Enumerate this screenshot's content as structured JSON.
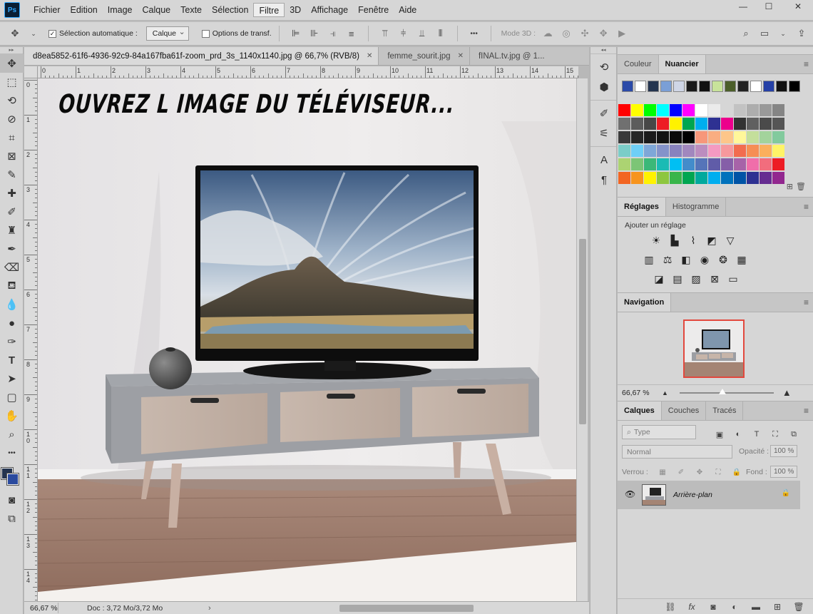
{
  "app": {
    "logo": "Ps"
  },
  "menu": [
    "Fichier",
    "Edition",
    "Image",
    "Calque",
    "Texte",
    "Sélection",
    "Filtre",
    "3D",
    "Affichage",
    "Fenêtre",
    "Aide"
  ],
  "menu_active_index": 6,
  "window_controls": {
    "minimize": "—",
    "maximize": "☐",
    "close": "✕"
  },
  "options": {
    "auto_select_label": "Sélection automatique :",
    "auto_select_checked": "✓",
    "auto_select_target": "Calque",
    "transform_label": "Options de transf.",
    "mode3d_label": "Mode 3D :",
    "more": "•••"
  },
  "doc_tabs": [
    {
      "label": "d8ea5852-61f6-4936-92c9-84a167fba61f-zoom_prd_3s_1140x1140.jpg @ 66,7% (RVB/8)",
      "close": "✕"
    },
    {
      "label": "femme_sourit.jpg",
      "close": "✕"
    },
    {
      "label": "fINAL.tv.jpg @ 1...",
      "close": ""
    }
  ],
  "rulers": {
    "top": [
      "0",
      "1",
      "2",
      "3",
      "4",
      "5",
      "6",
      "7",
      "8",
      "9",
      "10",
      "11",
      "12",
      "13",
      "14",
      "15"
    ],
    "left": [
      "0",
      "1",
      "2",
      "3",
      "4",
      "5",
      "6",
      "7",
      "8",
      "9",
      "10",
      "11",
      "12",
      "13",
      "14"
    ]
  },
  "canvas": {
    "headline": "OUVREZ L IMAGE DU TÉLÉVISEUR..."
  },
  "status": {
    "zoom": "66,67 %",
    "doc_info": "Doc : 3,72 Mo/3,72 Mo",
    "arrow": "›"
  },
  "panels": {
    "color": {
      "tabs": [
        "Couleur",
        "Nuancier"
      ]
    },
    "adjustments": {
      "tabs": [
        "Réglages",
        "Histogramme"
      ],
      "add_label": "Ajouter un réglage"
    },
    "navigation": {
      "tabs": [
        "Navigation"
      ],
      "zoom": "66,67 %"
    },
    "layers": {
      "tabs": [
        "Calques",
        "Couches",
        "Tracés"
      ],
      "filter_placeholder": "Type",
      "blend_mode": "Normal",
      "opacity_label": "Opacité :",
      "opacity_value": "100 %",
      "lock_label": "Verrou :",
      "fill_label": "Fond :",
      "fill_value": "100 %",
      "layer_name": "Arrière-plan"
    }
  },
  "swatch_colors": {
    "recent": [
      "#2b4aa8",
      "#ffffff",
      "#24344f",
      "#7a9fd6",
      "#cfd6e6",
      "#1a1a1a",
      "#111111",
      "#c8e39a",
      "#4b5e2a",
      "#222222",
      "#ffffff",
      "#2540a6",
      "#111111",
      "#000000"
    ],
    "grid": [
      [
        "#ff0000",
        "#ffff00",
        "#00ff00",
        "#00ffff",
        "#0000ff",
        "#ff00ff",
        "#ffffff",
        "#ebebeb",
        "#d6d6d6",
        "#c2c2c2",
        "#adadad",
        "#999999",
        "#858585"
      ],
      [
        "#707070",
        "#5c5c5c",
        "#474747",
        "#ed1c24",
        "#fff200",
        "#00a651",
        "#00aeef",
        "#2e3192",
        "#ec008c",
        "#333333",
        "#606060",
        "#4a4a4a",
        "#555555"
      ],
      [
        "#3a3a3a",
        "#262626",
        "#1a1a1a",
        "#121212",
        "#0a0a0a",
        "#000000",
        "#f7977a",
        "#f9ad81",
        "#fdc68a",
        "#fff79a",
        "#c4df9b",
        "#a3d39c",
        "#82ca9d"
      ],
      [
        "#7bcdc8",
        "#6ecff6",
        "#7ea7d8",
        "#8493ca",
        "#8882be",
        "#a187be",
        "#bc8dbf",
        "#f49ac2",
        "#f6989d",
        "#f26c4f",
        "#f68e55",
        "#fbaf5c",
        "#fff467"
      ],
      [
        "#acd372",
        "#7cc576",
        "#3bb878",
        "#1abbb4",
        "#00bff3",
        "#438ccb",
        "#5574b9",
        "#605ca8",
        "#855fa8",
        "#a763a8",
        "#f06eaa",
        "#f26d7d",
        "#ed1c24"
      ],
      [
        "#f26522",
        "#f7941d",
        "#fff200",
        "#8dc63f",
        "#39b54a",
        "#00a651",
        "#00a99d",
        "#00aeef",
        "#0072bc",
        "#0054a6",
        "#2e3192",
        "#662d91",
        "#92278f"
      ]
    ]
  },
  "colors": {
    "accent_nav_frame": "#e2483e",
    "foreground": "#24344f",
    "background": "#2a4a9e"
  }
}
